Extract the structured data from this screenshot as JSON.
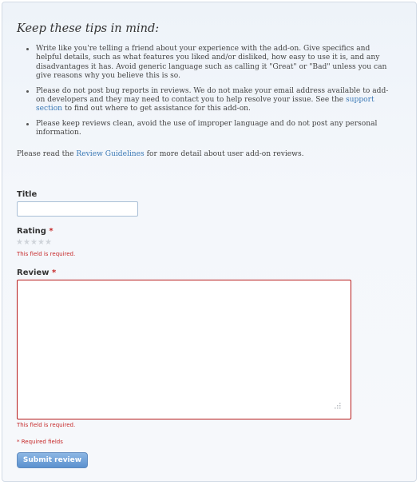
{
  "tips": {
    "heading": "Keep these tips in mind:",
    "items": [
      {
        "text": "Write like you're telling a friend about your experience with the add-on. Give specifics and helpful details, such as what features you liked and/or disliked, how easy to use it is, and any disadvantages it has. Avoid generic language such as calling it \"Great\" or \"Bad\" unless you can give reasons why you believe this is so."
      },
      {
        "before": "Please do not post bug reports in reviews. We do not make your email address available to add-on developers and they may need to contact you to help resolve your issue. See the ",
        "link": "support section",
        "after": " to find out where to get assistance for this add-on."
      },
      {
        "text": "Please keep reviews clean, avoid the use of improper language and do not post any personal information."
      }
    ],
    "guidelines_before": "Please read the ",
    "guidelines_link": "Review Guidelines",
    "guidelines_after": " for more detail about user add-on reviews."
  },
  "form": {
    "title_label": "Title",
    "title_value": "",
    "rating_label": "Rating",
    "required_mark": "*",
    "rating_stars": 5,
    "rating_value": 0,
    "rating_error": "This field is required.",
    "review_label": "Review",
    "review_value": "",
    "review_error": "This field is required.",
    "required_note": "* Required fields",
    "submit_label": "Submit review"
  },
  "colors": {
    "link": "#3a78b5",
    "error": "#c62828",
    "button": "#5b91cf"
  }
}
